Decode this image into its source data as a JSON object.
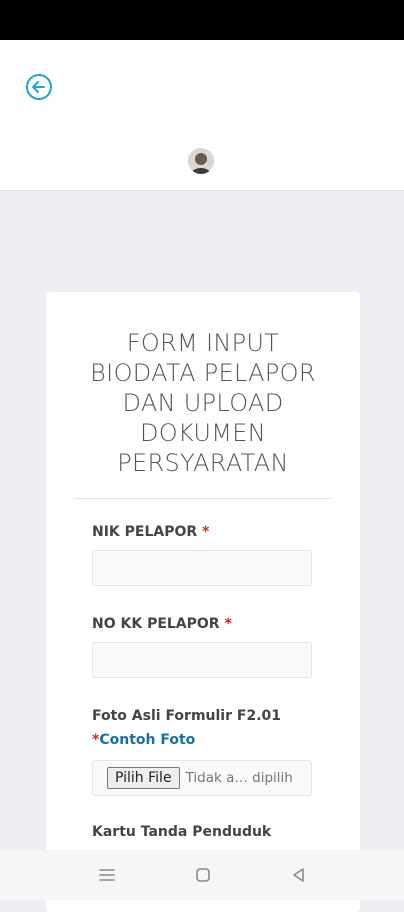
{
  "header": {
    "back_icon": "arrow-left-circle-icon",
    "avatar": "user-avatar"
  },
  "form": {
    "title_lines": [
      "FORM INPUT",
      "BIODATA PELAPOR",
      "DAN UPLOAD",
      "DOKUMEN",
      "PERSYARATAN"
    ],
    "nik_label": "NIK PELAPOR",
    "required_mark": "*",
    "nik_value": "",
    "kk_label": "NO KK PELAPOR",
    "kk_value": "",
    "foto_label": "Foto Asli Formulir F2.01",
    "example_link": "Contoh Foto",
    "file_button": "Pilih File",
    "file_status": "Tidak a… dipilih",
    "ktp_label": "Kartu Tanda Penduduk"
  },
  "nav": {
    "menu_icon": "menu-icon",
    "home_icon": "square-home-icon",
    "back_icon": "triangle-back-icon"
  },
  "colors": {
    "accent": "#2a9fd6",
    "link": "#1b6f9d",
    "required": "#e02020"
  }
}
